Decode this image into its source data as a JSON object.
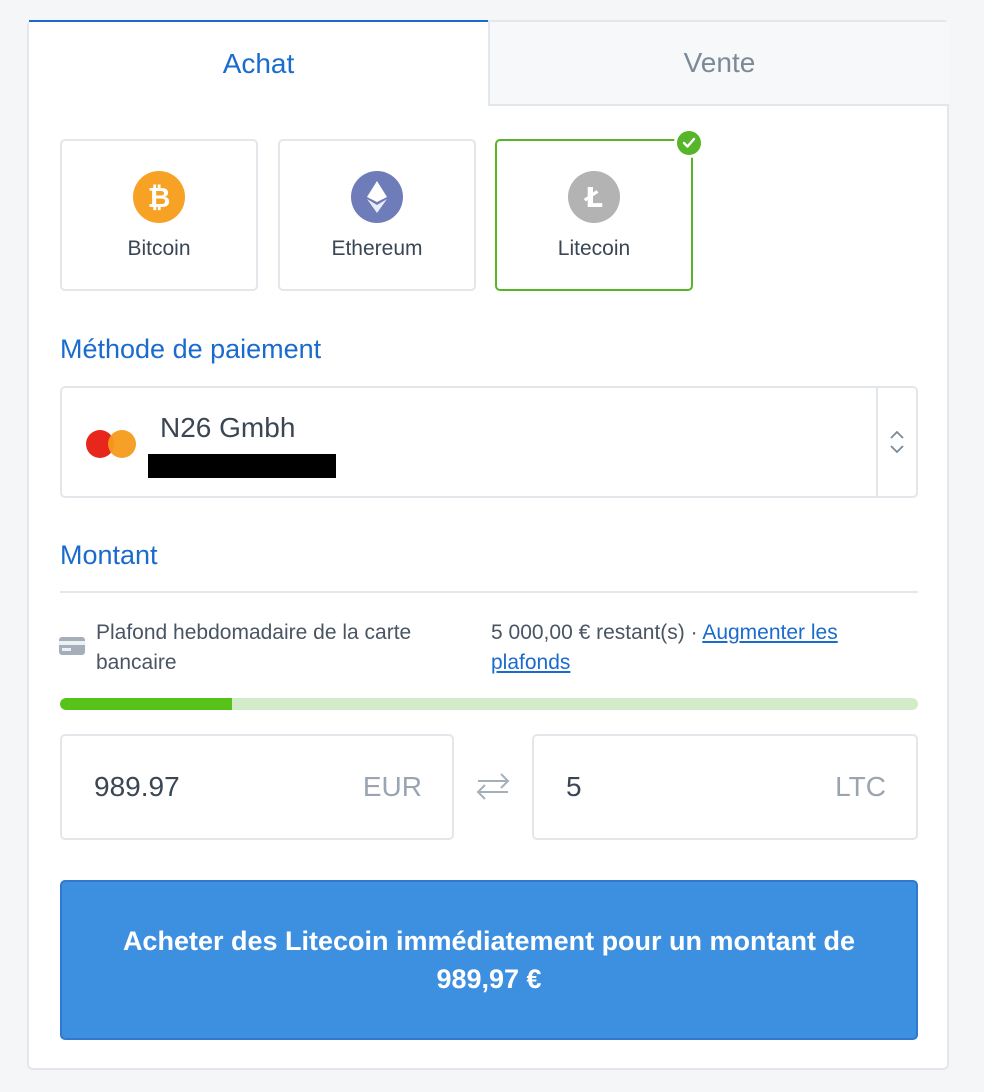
{
  "tabs": {
    "buy": "Achat",
    "sell": "Vente"
  },
  "coins": [
    {
      "label": "Bitcoin",
      "icon": "bitcoin-icon",
      "color": "#f7a224"
    },
    {
      "label": "Ethereum",
      "icon": "ethereum-icon",
      "color": "#6f7cba"
    },
    {
      "label": "Litecoin",
      "icon": "litecoin-icon",
      "color": "#b3b3b3",
      "selected": true
    }
  ],
  "payment": {
    "title": "Méthode de paiement",
    "name": "N26 Gmbh"
  },
  "amount": {
    "title": "Montant",
    "limit_label": "Plafond hebdomadaire de la carte bancaire",
    "limit_remaining": "5 000,00 € restant(s)",
    "separator": "·",
    "increase_link": "Augmenter les plafonds",
    "progress_fraction": 0.2,
    "fiat_value": "989.97",
    "fiat_currency": "EUR",
    "crypto_value": "5",
    "crypto_currency": "LTC"
  },
  "cta": {
    "label": "Acheter des Litecoin immédiatement pour un montant de 989,97 €"
  },
  "colors": {
    "accent": "#1a6bcd",
    "selected": "#57b52a",
    "cta": "#3d8fe0"
  }
}
